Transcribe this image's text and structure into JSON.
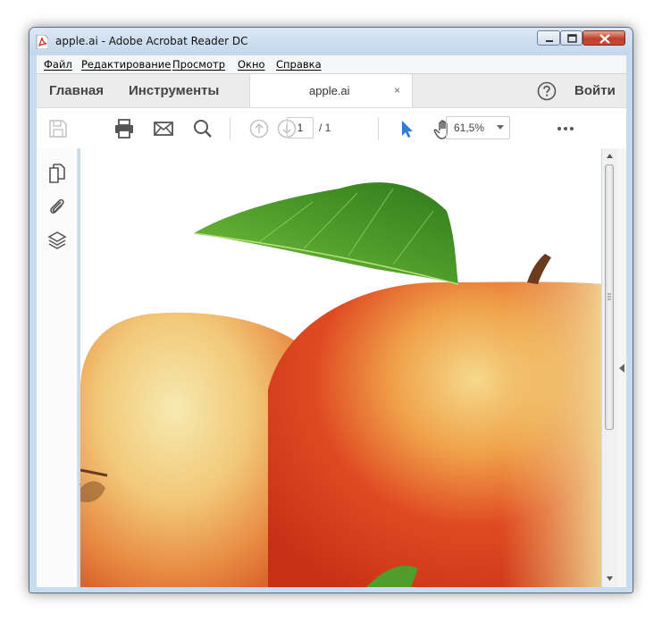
{
  "window": {
    "title": "apple.ai - Adobe Acrobat Reader DC"
  },
  "menu": {
    "items": [
      "Файл",
      "Редактирование",
      "Просмотр",
      "Окно",
      "Справка"
    ]
  },
  "tabs": {
    "home": "Главная",
    "tools": "Инструменты",
    "document": "apple.ai",
    "close_glyph": "×",
    "login": "Войти"
  },
  "toolbar": {
    "page_current": "1",
    "page_total": "/ 1",
    "zoom": "61,5%",
    "icons": [
      "save-icon",
      "print-icon",
      "email-icon",
      "search-icon",
      "page-up-icon",
      "page-down-icon",
      "select-cursor-icon",
      "hand-tool-icon",
      "more-icon"
    ]
  },
  "left_panel": {
    "icons": [
      "page-thumbnails-icon",
      "attachments-icon",
      "layers-icon"
    ]
  },
  "colors": {
    "accent": "#2d7cd6",
    "title_bar": "#c9dced"
  }
}
